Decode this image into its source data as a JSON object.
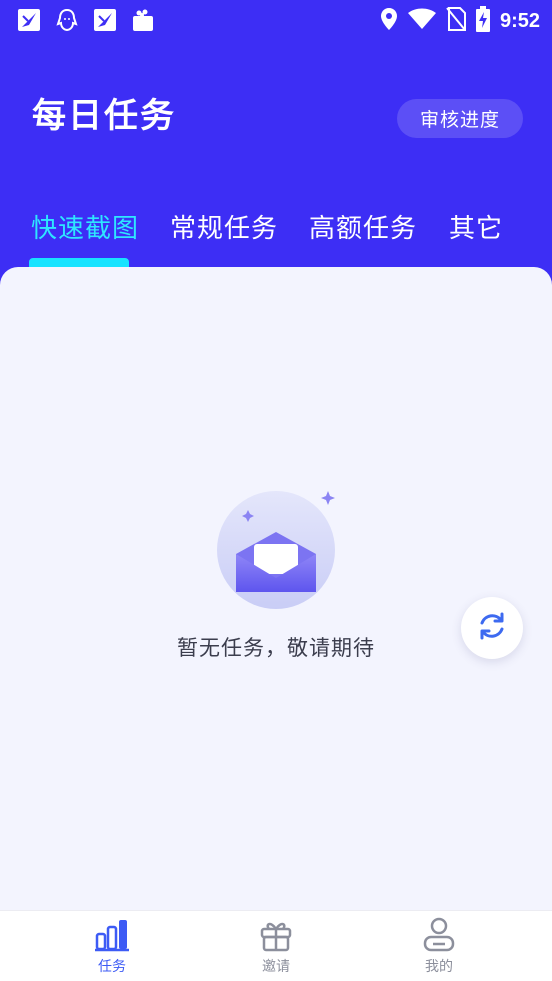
{
  "status_bar": {
    "time": "9:52",
    "left_icons": [
      "app-notification-icon",
      "qq-icon",
      "app-notification-icon",
      "bag-icon"
    ],
    "right_icons": [
      "location-icon",
      "wifi-icon",
      "no-sim-icon",
      "battery-charging-icon"
    ]
  },
  "header": {
    "title": "每日任务",
    "review_button": "审核进度"
  },
  "tabs": [
    {
      "label": "快速截图",
      "active": true
    },
    {
      "label": "常规任务",
      "active": false
    },
    {
      "label": "高额任务",
      "active": false
    },
    {
      "label": "其它",
      "active": false
    }
  ],
  "empty_state": {
    "icon": "empty-envelope-icon",
    "message": "暂无任务，敬请期待"
  },
  "refresh_icon": "refresh-icon",
  "bottom_nav": [
    {
      "label": "任务",
      "icon": "chart-bars-icon",
      "active": true
    },
    {
      "label": "邀请",
      "icon": "gift-icon",
      "active": false
    },
    {
      "label": "我的",
      "icon": "profile-icon",
      "active": false
    }
  ],
  "colors": {
    "header_bg": "#3d2ef5",
    "active_tab": "#2ee6ff",
    "content_bg": "#f3f4fe",
    "accent_blue": "#3d5bf5"
  }
}
